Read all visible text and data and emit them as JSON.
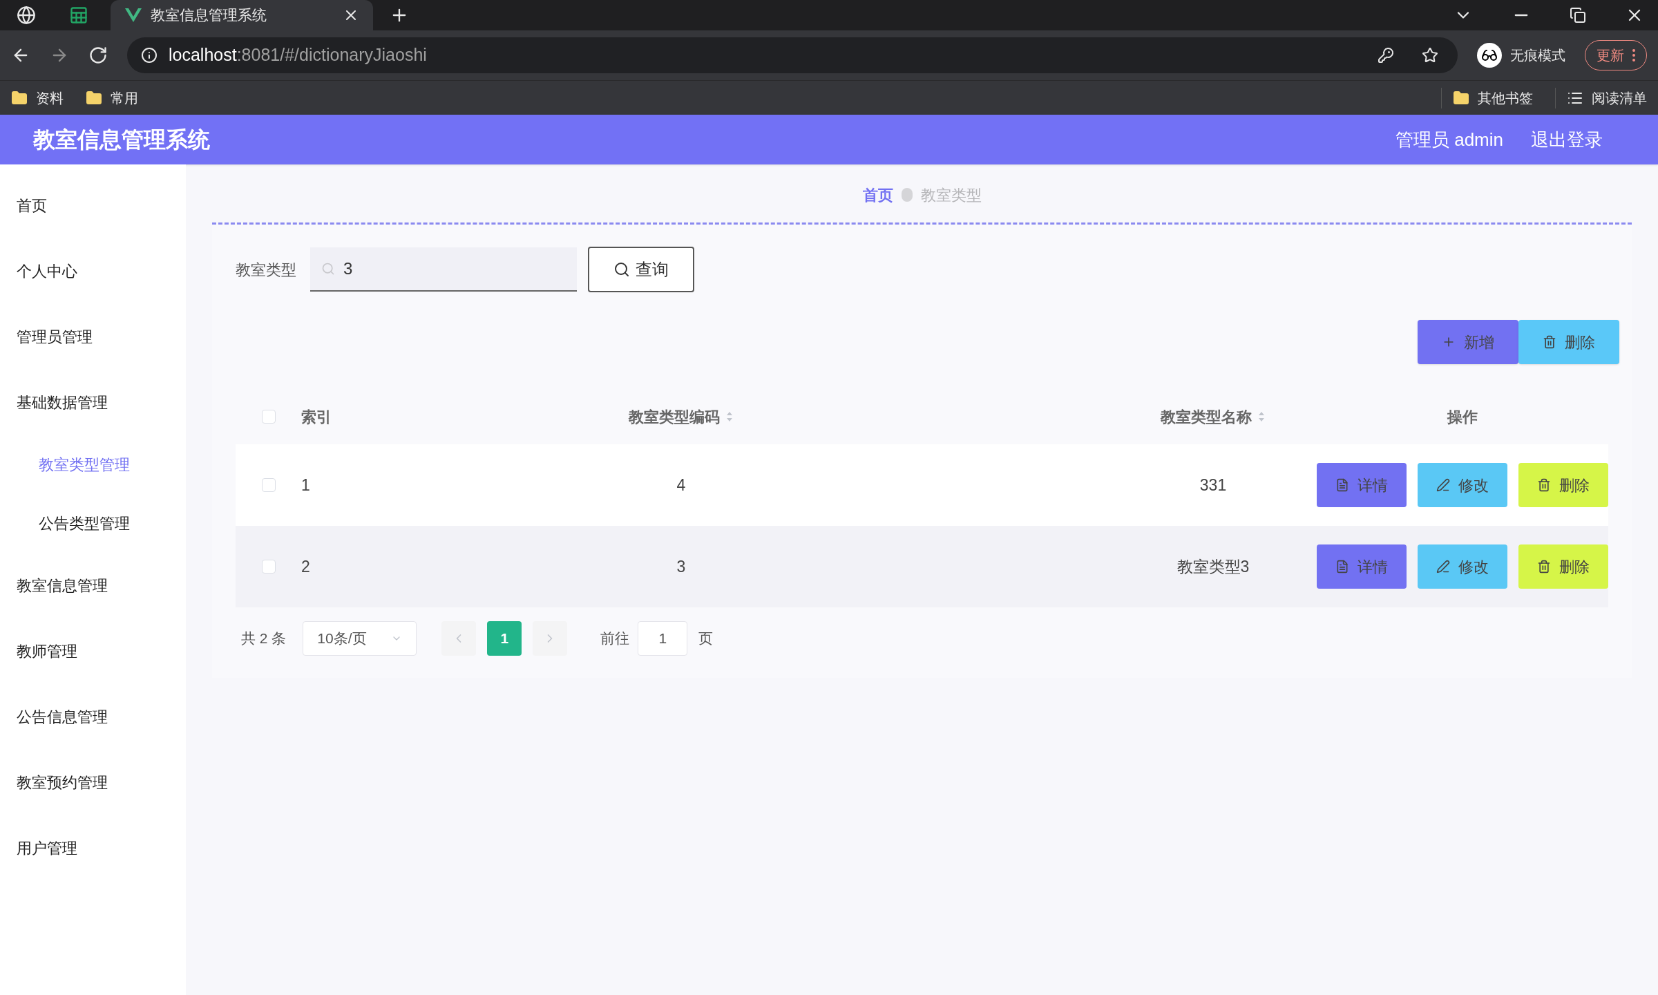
{
  "browser": {
    "tab_title": "教室信息管理系统",
    "url_host": "localhost",
    "url_rest": ":8081/#/dictionaryJiaoshi",
    "profile": "无痕模式",
    "update": "更新",
    "bookmarks_left": [
      "资料",
      "常用"
    ],
    "bookmarks_right": [
      {
        "label": "其他书签",
        "kind": "folder"
      },
      {
        "label": "阅读清单",
        "kind": "list"
      }
    ]
  },
  "header": {
    "title": "教室信息管理系统",
    "user": "管理员 admin",
    "logout": "退出登录"
  },
  "sidebar": {
    "items": [
      {
        "label": "首页"
      },
      {
        "label": "个人中心"
      },
      {
        "label": "管理员管理"
      },
      {
        "label": "基础数据管理",
        "children": [
          {
            "label": "教室类型管理",
            "selected": true
          },
          {
            "label": "公告类型管理",
            "selected": false
          }
        ]
      },
      {
        "label": "教室信息管理"
      },
      {
        "label": "教师管理"
      },
      {
        "label": "公告信息管理"
      },
      {
        "label": "教室预约管理"
      },
      {
        "label": "用户管理"
      }
    ]
  },
  "breadcrumb": [
    "首页",
    "教室类型"
  ],
  "search": {
    "label": "教室类型",
    "value": "3",
    "button": "查询"
  },
  "actions": [
    {
      "label": "新增",
      "kind": "add"
    },
    {
      "label": "删除",
      "kind": "delete"
    }
  ],
  "table": {
    "header_checked": false,
    "columns": [
      {
        "label": "索引",
        "sortable": false
      },
      {
        "label": "教室类型编码",
        "sortable": true
      },
      {
        "label": "教室类型名称",
        "sortable": true
      },
      {
        "label": "操作",
        "sortable": false
      }
    ],
    "rows": [
      {
        "checked": false,
        "cells": [
          "1",
          "4",
          "331"
        ],
        "buttons": [
          {
            "label": "详情",
            "kind": "detail"
          },
          {
            "label": "修改",
            "kind": "edit"
          },
          {
            "label": "删除",
            "kind": "delete"
          }
        ]
      },
      {
        "checked": false,
        "cells": [
          "2",
          "3",
          "教室类型3"
        ],
        "buttons": [
          {
            "label": "详情",
            "kind": "detail"
          },
          {
            "label": "修改",
            "kind": "edit"
          },
          {
            "label": "删除",
            "kind": "delete"
          }
        ]
      }
    ]
  },
  "pagination": {
    "total": "共 2 条",
    "page_size": "10条/页",
    "pages": [
      {
        "label": "1",
        "selected": true
      }
    ],
    "goto_label": "前往",
    "goto_value": "1",
    "goto_suffix": "页"
  }
}
